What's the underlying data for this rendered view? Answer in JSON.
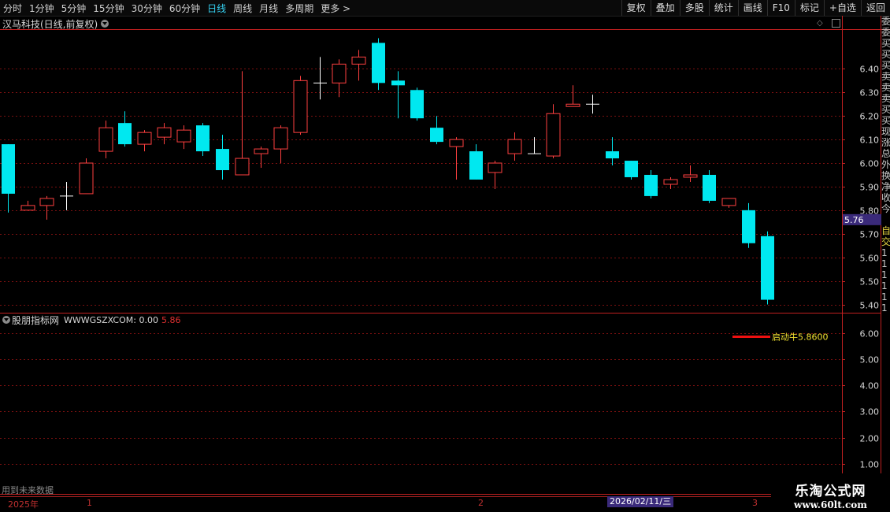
{
  "toolbar": {
    "periods": [
      "分时",
      "1分钟",
      "5分钟",
      "15分钟",
      "30分钟",
      "60分钟",
      "日线",
      "周线",
      "月线",
      "多周期",
      "更多 >"
    ],
    "active_period": "日线",
    "tools": [
      "复权",
      "叠加",
      "多股",
      "统计",
      "画线",
      "F10",
      "标记",
      "+自选",
      "返回"
    ]
  },
  "stock": {
    "title": "汉马科技(日线,前复权)"
  },
  "price_chart": {
    "yticks": [
      "6.40",
      "6.30",
      "6.20",
      "6.10",
      "6.00",
      "5.90",
      "5.80",
      "5.70",
      "5.60",
      "5.50",
      "5.40"
    ],
    "current_price": "5.76",
    "current_value": 5.76,
    "ylim": [
      5.365,
      6.565
    ],
    "candles": [
      [
        6.08,
        5.87,
        6.08,
        5.79
      ],
      [
        5.8,
        5.82,
        5.84,
        5.8
      ],
      [
        5.82,
        5.85,
        5.86,
        5.76
      ],
      [
        5.86,
        5.86,
        5.92,
        5.8
      ],
      [
        5.87,
        6.0,
        6.02,
        5.87
      ],
      [
        6.05,
        6.15,
        6.18,
        6.02
      ],
      [
        6.17,
        6.08,
        6.22,
        6.07
      ],
      [
        6.08,
        6.13,
        6.14,
        6.05
      ],
      [
        6.11,
        6.15,
        6.17,
        6.08
      ],
      [
        6.09,
        6.14,
        6.16,
        6.06
      ],
      [
        6.16,
        6.05,
        6.17,
        6.03
      ],
      [
        6.06,
        5.97,
        6.12,
        5.93
      ],
      [
        5.95,
        6.02,
        6.39,
        5.95
      ],
      [
        6.04,
        6.06,
        6.07,
        5.98
      ],
      [
        6.06,
        6.15,
        6.16,
        6.0
      ],
      [
        6.13,
        6.35,
        6.37,
        6.12
      ],
      [
        6.34,
        6.34,
        6.45,
        6.27
      ],
      [
        6.34,
        6.42,
        6.44,
        6.28
      ],
      [
        6.42,
        6.45,
        6.48,
        6.35
      ],
      [
        6.51,
        6.34,
        6.53,
        6.31
      ],
      [
        6.35,
        6.33,
        6.39,
        6.19
      ],
      [
        6.31,
        6.19,
        6.32,
        6.18
      ],
      [
        6.15,
        6.09,
        6.2,
        6.08
      ],
      [
        6.07,
        6.1,
        6.11,
        5.93
      ],
      [
        6.05,
        5.93,
        6.08,
        5.93
      ],
      [
        5.96,
        6.0,
        6.01,
        5.89
      ],
      [
        6.04,
        6.1,
        6.13,
        6.01
      ],
      [
        6.04,
        6.04,
        6.11,
        6.04
      ],
      [
        6.03,
        6.21,
        6.25,
        6.02
      ],
      [
        6.24,
        6.25,
        6.33,
        6.24
      ],
      [
        6.25,
        6.25,
        6.29,
        6.21
      ],
      [
        6.05,
        6.02,
        6.11,
        5.99
      ],
      [
        6.01,
        5.94,
        6.01,
        5.93
      ],
      [
        5.95,
        5.86,
        5.97,
        5.85
      ],
      [
        5.91,
        5.93,
        5.94,
        5.89
      ],
      [
        5.94,
        5.95,
        5.99,
        5.92
      ],
      [
        5.95,
        5.84,
        5.97,
        5.83
      ],
      [
        5.82,
        5.85,
        5.85,
        5.81
      ],
      [
        5.8,
        5.66,
        5.83,
        5.64
      ],
      [
        5.69,
        5.42,
        5.71,
        5.4
      ]
    ]
  },
  "indicator": {
    "name": "股朋指标网",
    "formula": "WWWGSZXCOM: 0.00",
    "value": "5.86",
    "yticks": [
      "6.00",
      "5.00",
      "4.00",
      "3.00",
      "2.00",
      "1.00"
    ],
    "ylim": [
      0.75,
      6.75
    ],
    "signal_value": 5.86,
    "signal_label": "启动牛5.8600"
  },
  "right_panel": {
    "lines": [
      "委",
      "委",
      "买",
      "买",
      "买",
      "卖",
      "卖",
      "卖",
      "买",
      "买",
      "现",
      "涨",
      "总",
      "外",
      "换",
      "净",
      "收",
      "今",
      "自",
      "交",
      "1",
      "1",
      "1",
      "1",
      "1",
      "1"
    ]
  },
  "timeline": {
    "year": "2025年",
    "months": [
      "1",
      "2",
      "3"
    ],
    "cursor_date": "2026/02/11/三"
  },
  "footer": {
    "note": "用到未来数据"
  },
  "watermark": {
    "title": "乐淘公式网",
    "url": "www.60lt.com"
  },
  "colors": {
    "up": "#ff4040",
    "down": "#00e8f0",
    "flat": "#ffffff",
    "grid": "#7a1010",
    "axis": "#c02020",
    "tick_text": "#d8d8d8",
    "price_tag_bg": "#3a2a7a",
    "signal_line": "#ee1010",
    "signal_text": "#f0e030",
    "active_tab": "#35d0f0"
  }
}
